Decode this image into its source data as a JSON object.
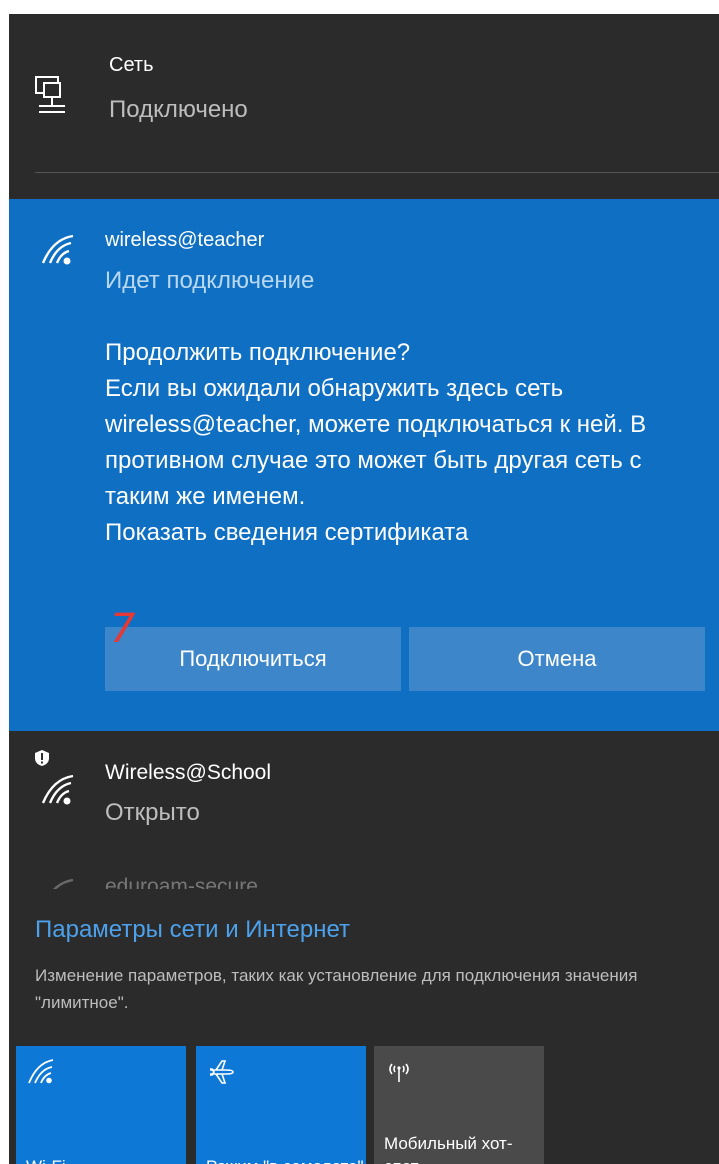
{
  "wired": {
    "name": "Сеть",
    "status": "Подключено",
    "icon": "ethernet-monitor-icon"
  },
  "selected_network": {
    "name": "wireless@teacher",
    "status": "Идет подключение",
    "prompt_title": "Продолжить подключение?",
    "prompt_body": "Если вы ожидали обнаружить здесь сеть wireless@teacher, можете подключаться к ней. В противном случае это может быть другая сеть с таким же именем.",
    "cert_link": "Показать сведения сертификата",
    "connect_label": "Подключиться",
    "cancel_label": "Отмена",
    "step_annotation": "7",
    "accent_color": "#0e6fc3"
  },
  "other_network": {
    "name": "Wireless@School",
    "status": "Открыто",
    "icon": "wifi-shield-icon"
  },
  "partial_network": {
    "name": "eduroam-secure"
  },
  "settings": {
    "title": "Параметры сети и Интернет",
    "description": "Изменение параметров, таких как установление для подключения значения \"лимитное\"."
  },
  "tiles": [
    {
      "label": "Wi-Fi",
      "icon": "wifi-icon",
      "active": true
    },
    {
      "label": "Режим \"в самолете\"",
      "icon": "airplane-icon",
      "active": true
    },
    {
      "label": "Мобильный хот-спот",
      "icon": "hotspot-icon",
      "active": false
    }
  ]
}
